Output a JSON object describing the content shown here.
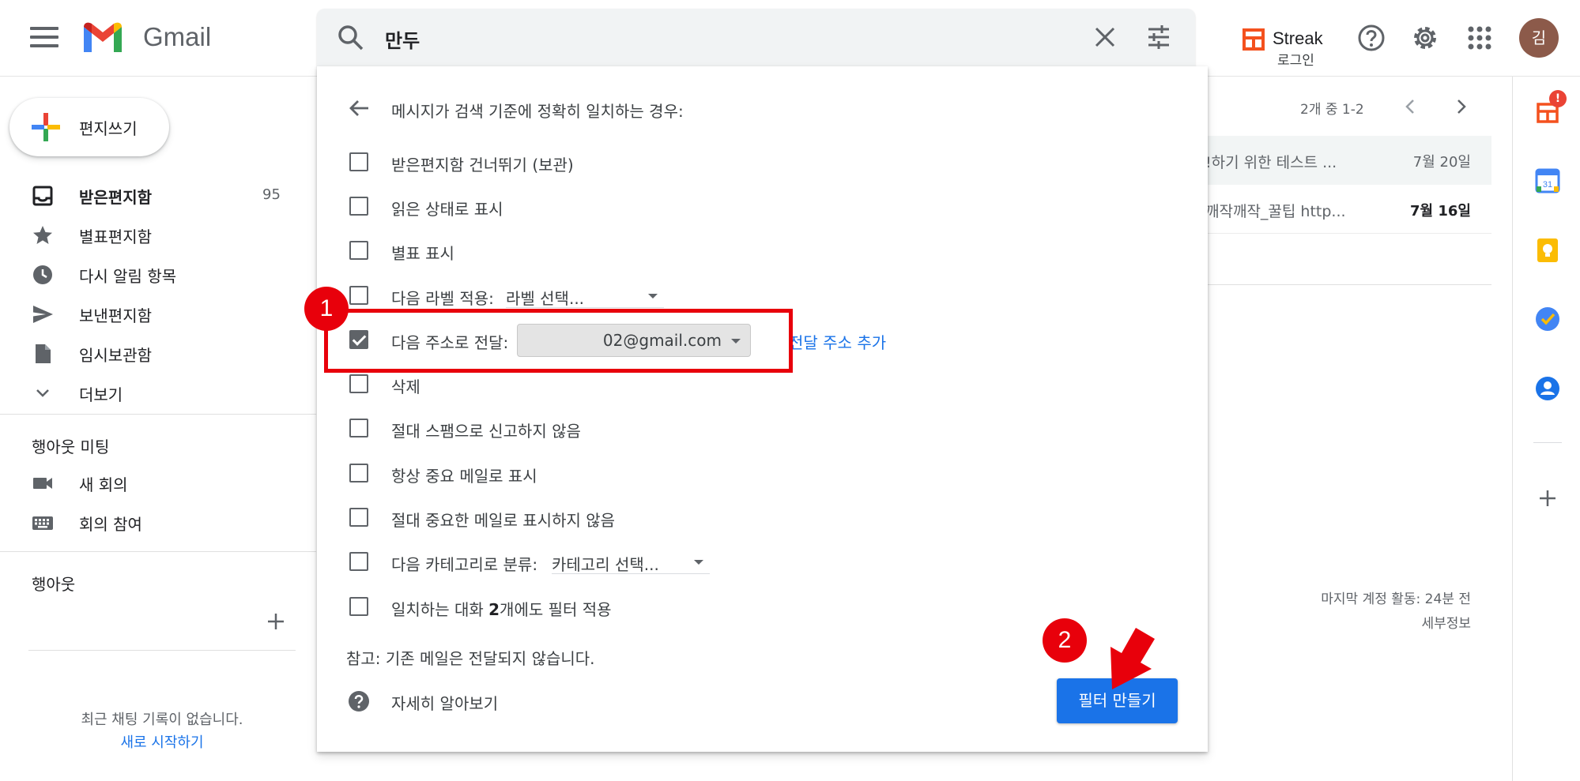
{
  "header": {
    "app_name": "Gmail",
    "search_query": "만두",
    "streak_name": "Streak",
    "streak_action": "로그인",
    "avatar_letter": "김"
  },
  "sidebar": {
    "compose_label": "편지쓰기",
    "items": [
      {
        "label": "받은편지함",
        "count": "95",
        "icon": "inbox-icon",
        "bold": true
      },
      {
        "label": "별표편지함",
        "count": "",
        "icon": "star-icon"
      },
      {
        "label": "다시 알림 항목",
        "count": "",
        "icon": "clock-icon"
      },
      {
        "label": "보낸편지함",
        "count": "",
        "icon": "send-icon"
      },
      {
        "label": "임시보관함",
        "count": "",
        "icon": "draft-icon"
      },
      {
        "label": "더보기",
        "count": "",
        "icon": "chevron-down-icon"
      }
    ],
    "meet_title": "행아웃 미팅",
    "meet_items": [
      {
        "label": "새 회의",
        "icon": "video-icon"
      },
      {
        "label": "회의 참여",
        "icon": "keyboard-icon"
      }
    ],
    "hangouts_title": "행아웃",
    "no_chat": "최근 채팅 기록이 없습니다.",
    "start_link": "새로 시작하기"
  },
  "mail_list": {
    "pager": "2개 중 1-2",
    "rows": [
      {
        "snippet": "!하기 위한 테스트 ...",
        "date": "7월 20일"
      },
      {
        "snippet": "깨작깨작_꿀팁 http...",
        "date": "7월 16일"
      }
    ],
    "last_activity": "마지막 계정 활동: 24분 전",
    "details": "세부정보"
  },
  "side_panel": {
    "badge": "!"
  },
  "filter_panel": {
    "title": "메시지가 검색 기준에 정확히 일치하는 경우:",
    "options": [
      {
        "label": "받은편지함 건너뛰기 (보관)",
        "checked": false
      },
      {
        "label": "읽은 상태로 표시",
        "checked": false
      },
      {
        "label": "별표 표시",
        "checked": false
      },
      {
        "label": "다음 라벨 적용:",
        "checked": false,
        "select": "라벨 선택..."
      },
      {
        "label": "다음 주소로 전달:",
        "checked": true,
        "select": "02@gmail.com"
      },
      {
        "label": "삭제",
        "checked": false
      },
      {
        "label": "절대 스팸으로 신고하지 않음",
        "checked": false
      },
      {
        "label": "항상 중요 메일로 표시",
        "checked": false
      },
      {
        "label": "절대 중요한 메일로 표시하지 않음",
        "checked": false
      },
      {
        "label": "다음 카테고리로 분류:",
        "checked": false,
        "select": "카테고리 선택..."
      },
      {
        "label_pre": "일치하는 대화 ",
        "label_bold": "2",
        "label_post": "개에도 필터 적용",
        "checked": false
      }
    ],
    "add_forward_link": "전달 주소 추가",
    "note": "참고: 기존 메일은 전달되지 않습니다.",
    "learn_more": "자세히 알아보기",
    "create_button": "필터 만들기"
  },
  "annotations": {
    "step1": "1",
    "step2": "2"
  },
  "colors": {
    "accent": "#1a73e8",
    "annotation_red": "#e8000b"
  }
}
